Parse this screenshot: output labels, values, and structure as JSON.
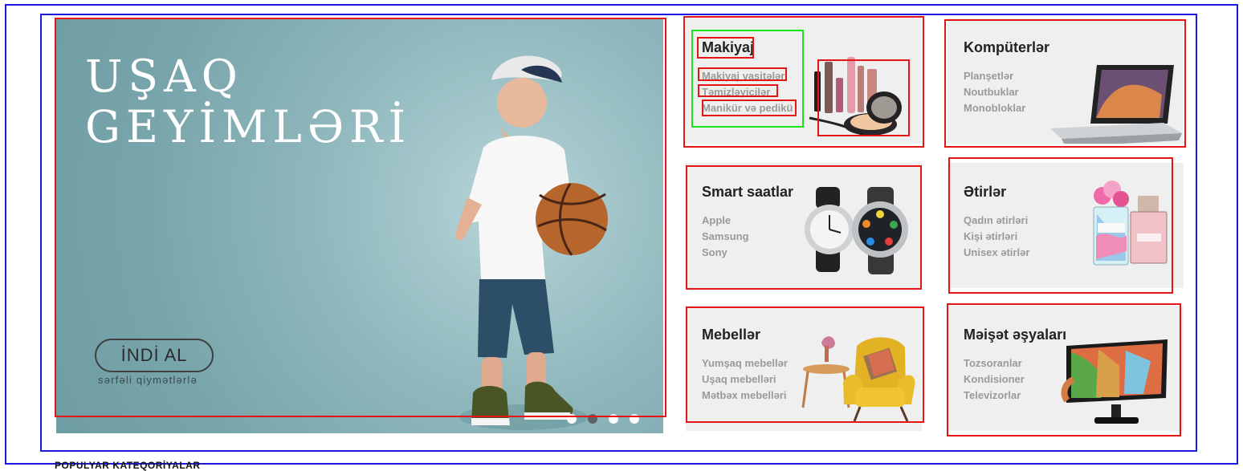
{
  "hero": {
    "title": "UŞAQ\nGEYİMLƏRİ",
    "button_label": "İNDİ AL",
    "subtitle": "sərfəli qiymətlərlə",
    "slider_dots": 4,
    "active_dot_index": 1
  },
  "categories": [
    {
      "title": "Makiyaj",
      "links": [
        "Makiyaj vasitələr",
        "Təmizləyicilər",
        "Manikür və pedikü"
      ],
      "icon": "makeup-products-icon"
    },
    {
      "title": "Kompüterlər",
      "links": [
        "Planşetlər",
        "Noutbuklar",
        "Monobloklar"
      ],
      "icon": "laptop-icon"
    },
    {
      "title": "Smart saatlar",
      "links": [
        "Apple",
        "Samsung",
        "Sony"
      ],
      "icon": "smartwatch-icon"
    },
    {
      "title": "Ətirlər",
      "links": [
        "Qadın ətirləri",
        "Kişi ətirləri",
        "Unisex ətirlər"
      ],
      "icon": "perfume-icon"
    },
    {
      "title": "Mebellər",
      "links": [
        "Yumşaq mebellər",
        "Uşaq mebelləri",
        "Mətbəx mebelləri"
      ],
      "icon": "armchair-icon"
    },
    {
      "title": "Məişət əşyaları",
      "links": [
        "Tozsoranlar",
        "Kondisioner",
        "Televizorlar"
      ],
      "icon": "television-icon"
    }
  ],
  "footer": {
    "section_label": "POPULYAR KATEQORİYALAR"
  },
  "colors": {
    "annotation_blue": "#1a1adf",
    "annotation_red": "#e31515",
    "annotation_green": "#18e318",
    "hero_teal": "#78a5ab",
    "card_background": "#efefef",
    "link_gray": "#9a9a9a"
  }
}
